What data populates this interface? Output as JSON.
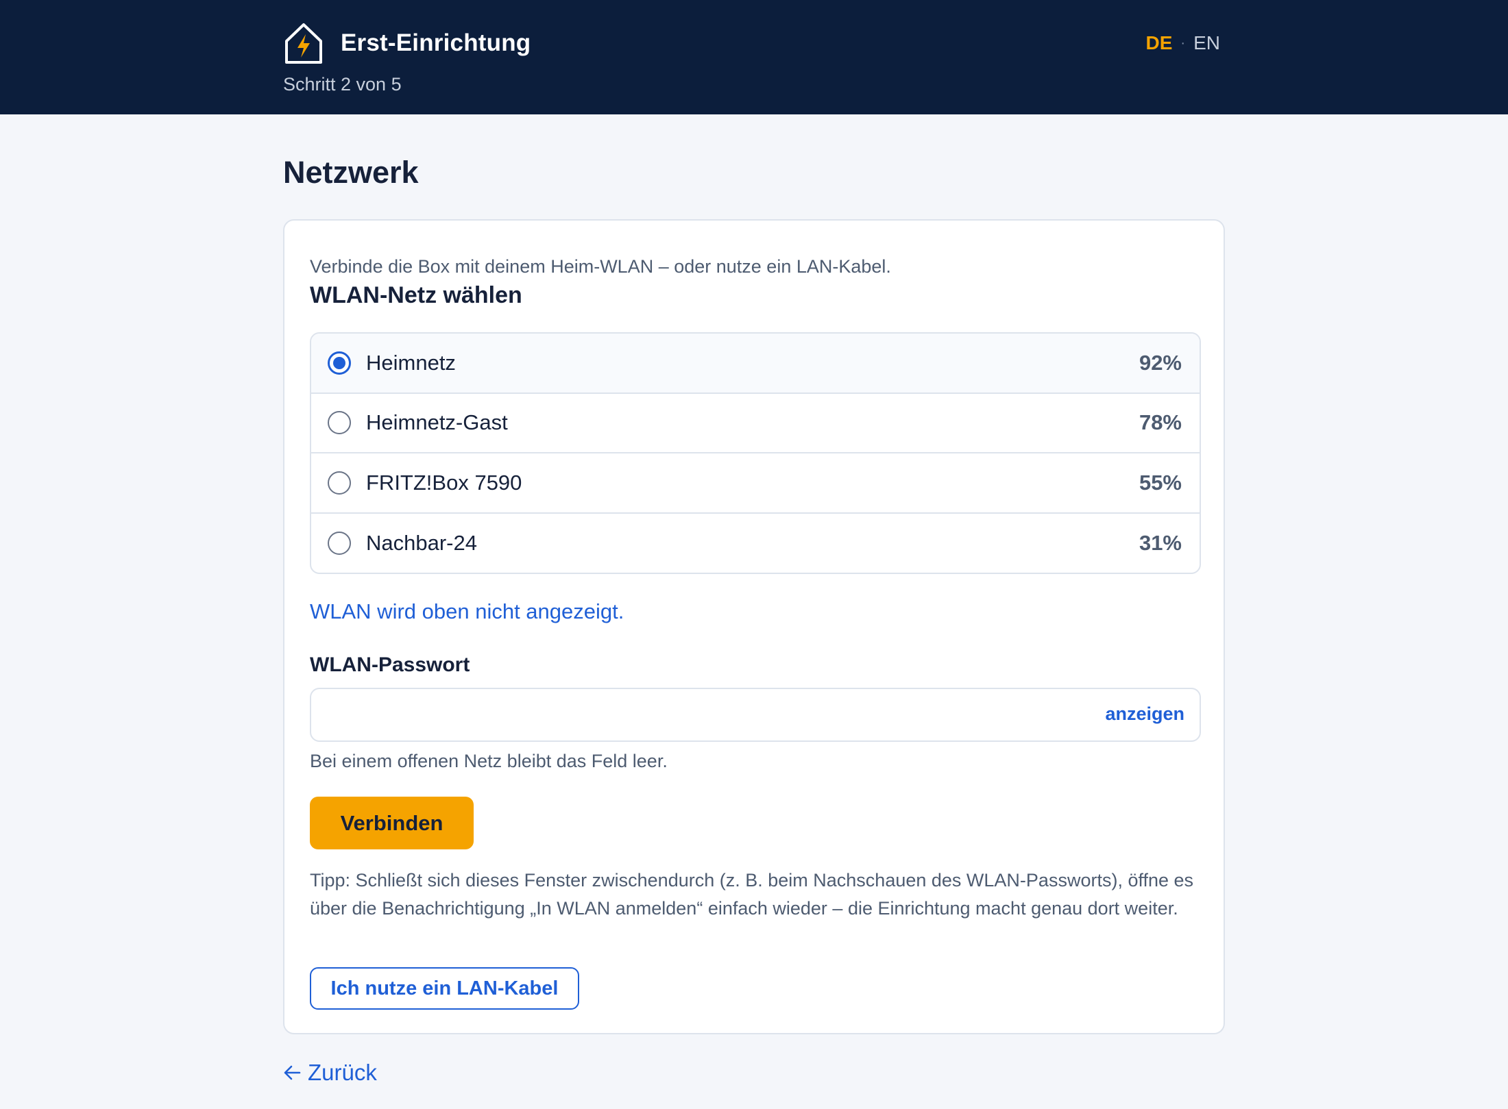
{
  "header": {
    "title": "Erst-Einrichtung",
    "step": "Schritt 2 von 5",
    "logo_icon": "house-bolt-icon",
    "languages": {
      "active": "DE",
      "separator": "·",
      "other": "EN"
    }
  },
  "colors": {
    "header_bg": "#0c1e3c",
    "accent": "#f5a300",
    "link": "#1f5fd6",
    "page_bg": "#f4f6fa"
  },
  "page": {
    "title": "Netzwerk"
  },
  "card": {
    "intro": "Verbinde die Box mit deinem Heim-WLAN – oder nutze ein LAN-Kabel.",
    "section_title": "WLAN-Netz wählen",
    "networks": [
      {
        "name": "Heimnetz",
        "signal": "92%",
        "selected": true
      },
      {
        "name": "Heimnetz-Gast",
        "signal": "78%",
        "selected": false
      },
      {
        "name": "FRITZ!Box 7590",
        "signal": "55%",
        "selected": false
      },
      {
        "name": "Nachbar-24",
        "signal": "31%",
        "selected": false
      }
    ],
    "hidden_network_link": "WLAN wird oben nicht angezeigt.",
    "password": {
      "label": "WLAN-Passwort",
      "value": "",
      "placeholder": "",
      "show_label": "anzeigen",
      "hint": "Bei einem offenen Netz bleibt das Feld leer."
    },
    "connect_button": "Verbinden",
    "tip": "Tipp: Schließt sich dieses Fenster zwischendurch (z. B. beim Nachschauen des WLAN-Passworts), öffne es über die Benachrichtigung „In WLAN anmelden“ einfach wieder – die Einrichtung macht genau dort weiter.",
    "lan_button": "Ich nutze ein LAN-Kabel"
  },
  "footer": {
    "back_label": "Zurück",
    "back_icon": "arrow-left-icon"
  }
}
